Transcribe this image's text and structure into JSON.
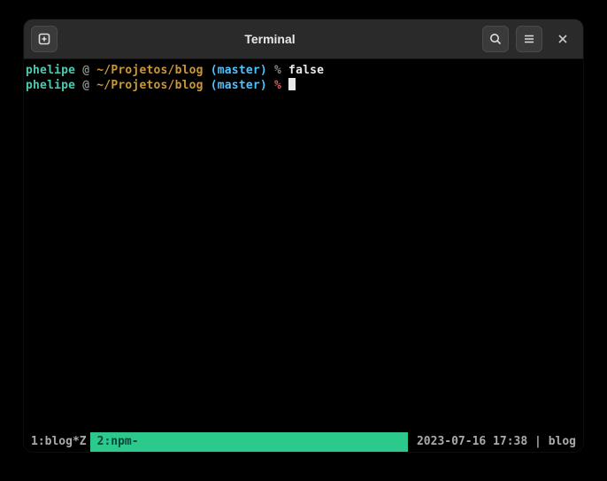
{
  "titlebar": {
    "title": "Terminal"
  },
  "lines": [
    {
      "user": "phelipe",
      "at": "@",
      "path": "~/Projetos/blog",
      "branch_open": "(",
      "branch": "master",
      "branch_close": ")",
      "percent": "%",
      "percent_class": "percent-ok",
      "command": "false",
      "has_cursor": false
    },
    {
      "user": "phelipe",
      "at": "@",
      "path": "~/Projetos/blog",
      "branch_open": "(",
      "branch": "master",
      "branch_close": ")",
      "percent": "%",
      "percent_class": "percent-err",
      "command": "",
      "has_cursor": true
    }
  ],
  "status": {
    "tab1": "1:blog*Z",
    "tab2": "2:npm-",
    "datetime": "2023-07-16 17:38",
    "sep": " | ",
    "session": "blog"
  }
}
